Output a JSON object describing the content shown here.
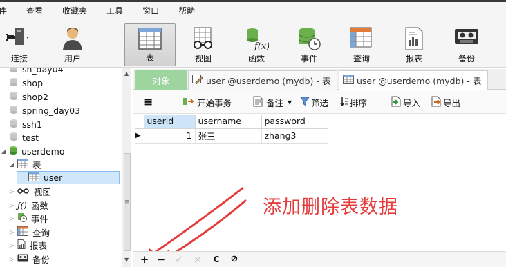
{
  "menu": [
    "件",
    "查看",
    "收藏夹",
    "工具",
    "窗口",
    "帮助"
  ],
  "toolbar": {
    "connect": "连接",
    "user": "用户",
    "table": "表",
    "view": "视图",
    "function": "函数",
    "event": "事件",
    "query": "查询",
    "report": "报表",
    "backup": "备份",
    "function_glyph": "f(x)"
  },
  "tree": {
    "items": [
      "sh_day04",
      "shop",
      "shop2",
      "spring_day03",
      "ssh1",
      "test",
      "userdemo",
      "表",
      "user",
      "视图",
      "函数",
      "事件",
      "查询",
      "报表",
      "备份"
    ]
  },
  "tabs": {
    "object": "对象",
    "tab1": "user @userdemo (mydb) - 表",
    "tab2": "user @userdemo (mydb) - 表"
  },
  "table_toolbar": {
    "begin_transaction": "开始事务",
    "memo": "备注",
    "filter": "筛选",
    "sort": "排序",
    "import": "导入",
    "export": "导出"
  },
  "grid": {
    "columns": [
      "userid",
      "username",
      "password"
    ],
    "rows": [
      [
        "1",
        "张三",
        "zhang3"
      ]
    ]
  },
  "annotation": "添加删除表数据",
  "bottom": {
    "add": "+",
    "remove": "−",
    "apply": "✓",
    "cancel": "×",
    "refresh": "C",
    "stop": "⊘"
  },
  "colors": {
    "accent_green": "#9ed59f",
    "annotation_red": "#e53b3b",
    "selection_blue": "#cfe6fb"
  }
}
